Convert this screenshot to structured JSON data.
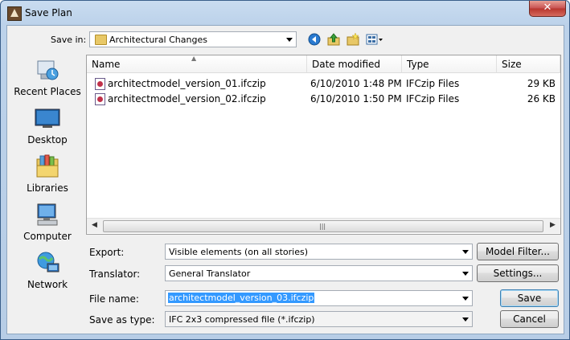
{
  "window": {
    "title": "Save Plan",
    "close_glyph": "✕"
  },
  "toolbar": {
    "save_in_label": "Save in:",
    "save_in_value": "Architectural Changes",
    "icons": [
      "back-icon",
      "up-folder-icon",
      "new-folder-icon",
      "views-menu-icon"
    ]
  },
  "places": [
    {
      "label": "Recent Places",
      "icon": "recent-places-icon"
    },
    {
      "label": "Desktop",
      "icon": "desktop-icon"
    },
    {
      "label": "Libraries",
      "icon": "libraries-icon"
    },
    {
      "label": "Computer",
      "icon": "computer-icon"
    },
    {
      "label": "Network",
      "icon": "network-icon"
    }
  ],
  "list": {
    "columns": [
      "Name",
      "Date modified",
      "Type",
      "Size"
    ],
    "rows": [
      {
        "name": "architectmodel_version_01.ifczip",
        "date": "6/10/2010 1:48 PM",
        "type": "IFCzip Files",
        "size": "29 KB"
      },
      {
        "name": "architectmodel_version_02.ifczip",
        "date": "6/10/2010 1:50 PM",
        "type": "IFCzip Files",
        "size": "26 KB"
      }
    ]
  },
  "form": {
    "export_label": "Export:",
    "export_value": "Visible elements (on all stories)",
    "translator_label": "Translator:",
    "translator_value": "General Translator",
    "filename_label": "File name:",
    "filename_value": "architectmodel_version_03.ifczip",
    "saveastype_label": "Save as type:",
    "saveastype_value": "IFC 2x3 compressed file (*.ifczip)"
  },
  "buttons": {
    "model_filter": "Model Filter...",
    "settings": "Settings...",
    "save": "Save",
    "cancel": "Cancel"
  },
  "colors": {
    "selection": "#3399ff",
    "title_gradient": "#c9dcf0",
    "close_button": "#c75050"
  }
}
